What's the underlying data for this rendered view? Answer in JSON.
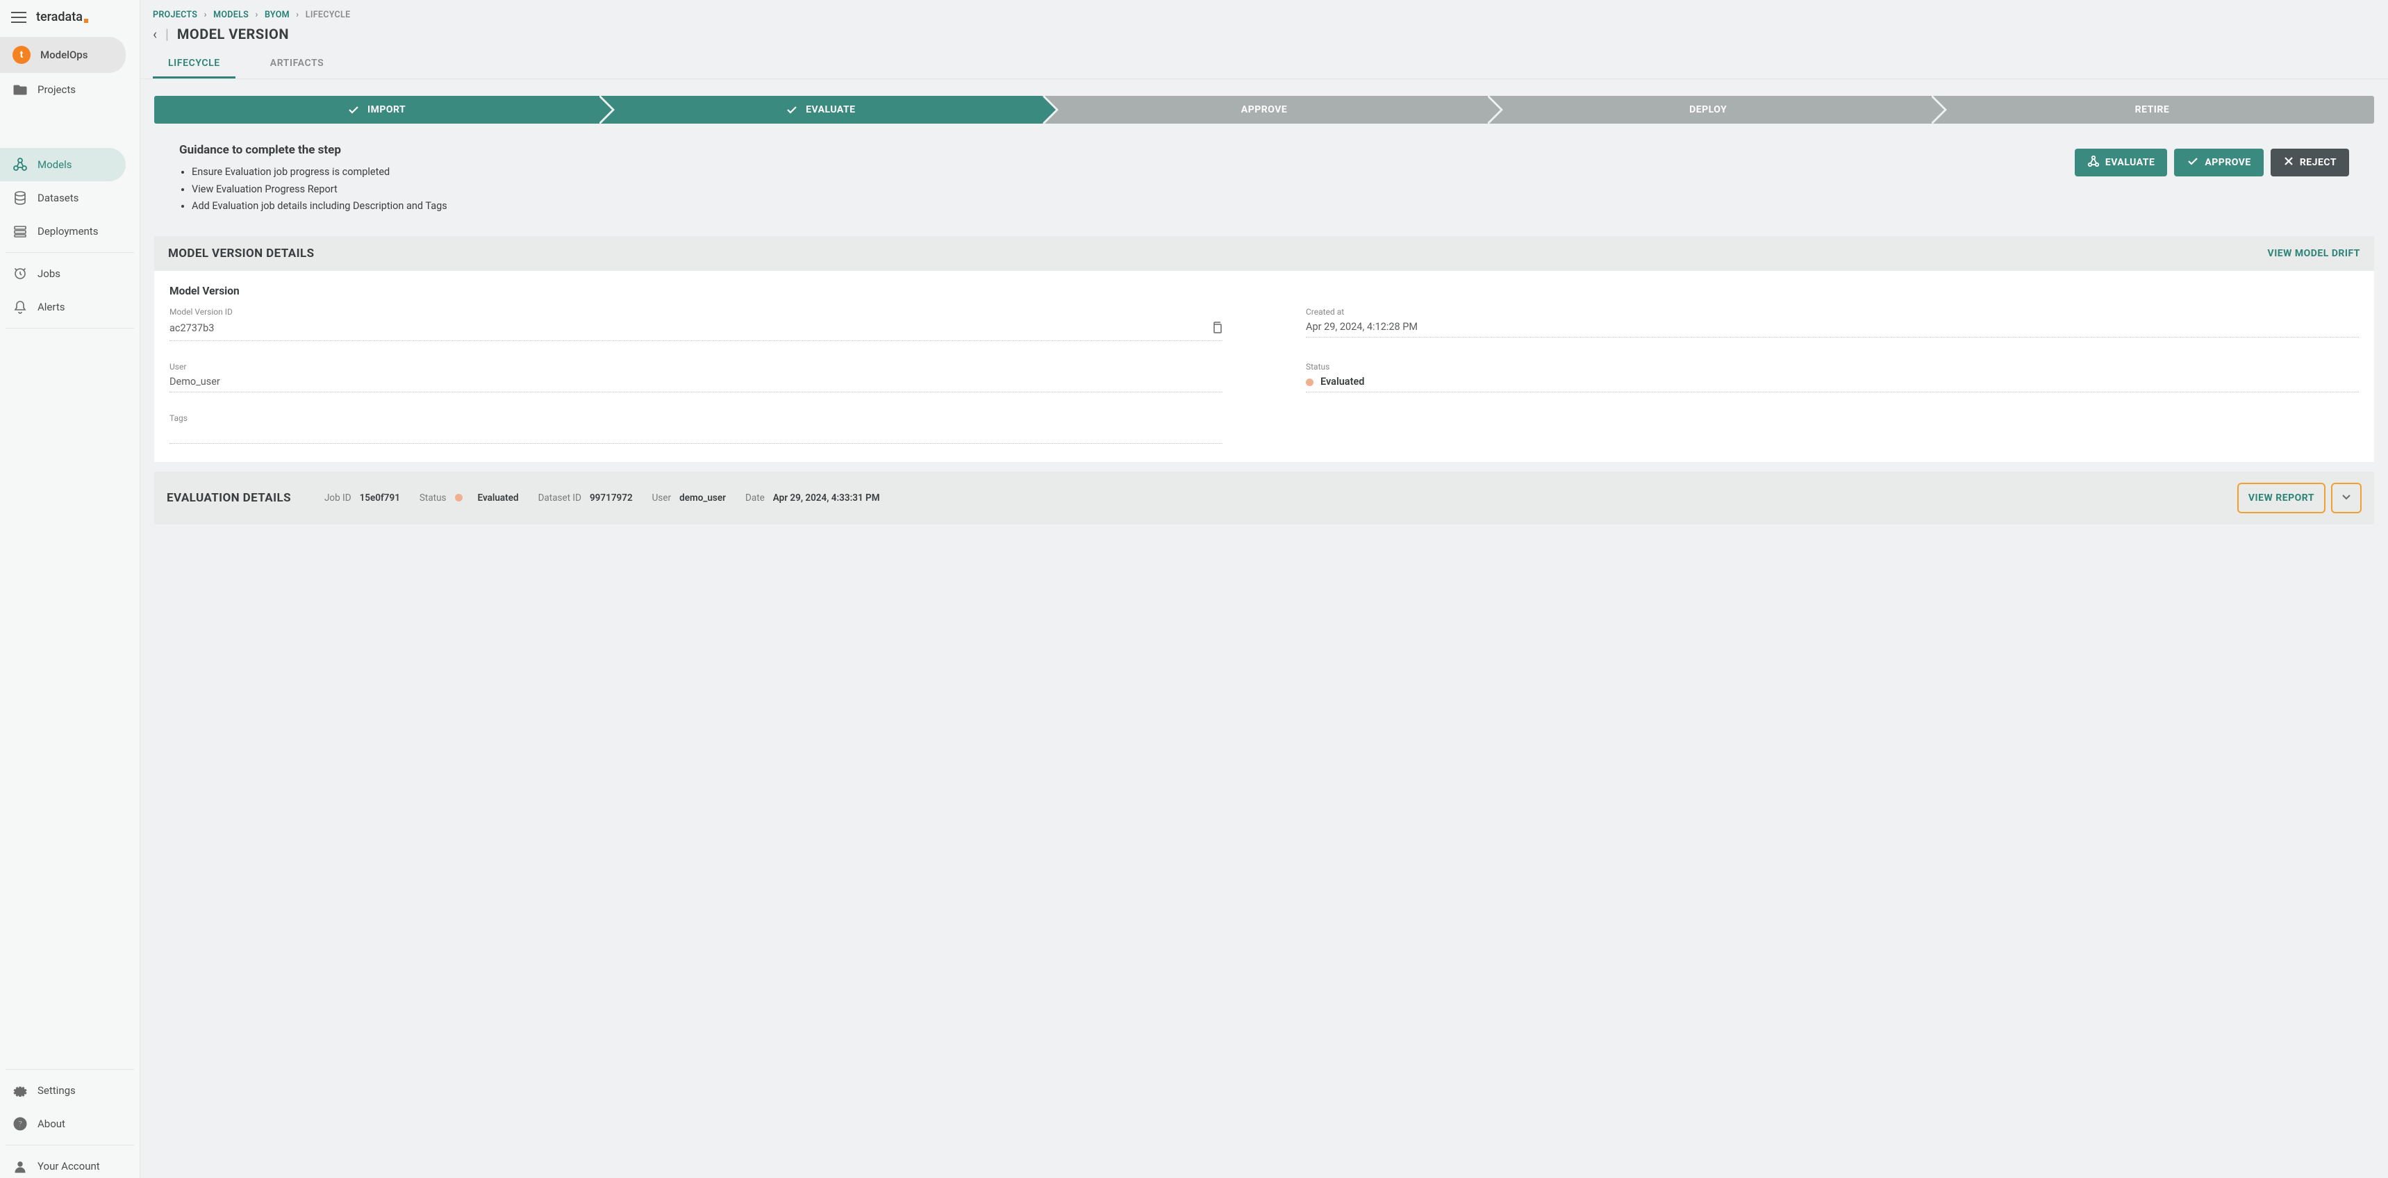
{
  "logo": "teradata",
  "nav": {
    "modelops": "ModelOps",
    "projects": "Projects",
    "models": "Models",
    "datasets": "Datasets",
    "deployments": "Deployments",
    "jobs": "Jobs",
    "alerts": "Alerts",
    "settings": "Settings",
    "about": "About",
    "account": "Your Account"
  },
  "breadcrumbs": {
    "projects": "PROJECTS",
    "models": "MODELS",
    "byom": "BYOM",
    "lifecycle": "LIFECYCLE"
  },
  "page_title": "MODEL VERSION",
  "tabs": {
    "lifecycle": "LIFECYCLE",
    "artifacts": "ARTIFACTS"
  },
  "steps": {
    "import": "IMPORT",
    "evaluate": "EVALUATE",
    "approve": "APPROVE",
    "deploy": "DEPLOY",
    "retire": "RETIRE"
  },
  "guidance": {
    "heading": "Guidance to complete the step",
    "items": [
      "Ensure Evaluation job progress is completed",
      "View Evaluation Progress Report",
      "Add Evaluation job details including Description and Tags"
    ]
  },
  "actions": {
    "evaluate": "EVALUATE",
    "approve": "APPROVE",
    "reject": "REJECT"
  },
  "details": {
    "header": "MODEL VERSION DETAILS",
    "view_drift": "VIEW MODEL DRIFT",
    "section_title": "Model Version",
    "id_label": "Model Version ID",
    "id_value": "ac2737b3",
    "created_label": "Created at",
    "created_value": "Apr 29, 2024, 4:12:28 PM",
    "user_label": "User",
    "user_value": "Demo_user",
    "status_label": "Status",
    "status_value": "Evaluated",
    "tags_label": "Tags"
  },
  "evaluation": {
    "header": "EVALUATION DETAILS",
    "jobid_label": "Job ID",
    "jobid_value": "15e0f791",
    "status_label": "Status",
    "status_value": "Evaluated",
    "dataset_label": "Dataset ID",
    "dataset_value": "99717972",
    "user_label": "User",
    "user_value": "demo_user",
    "date_label": "Date",
    "date_value": "Apr 29, 2024, 4:33:31 PM",
    "view_report": "VIEW REPORT"
  }
}
